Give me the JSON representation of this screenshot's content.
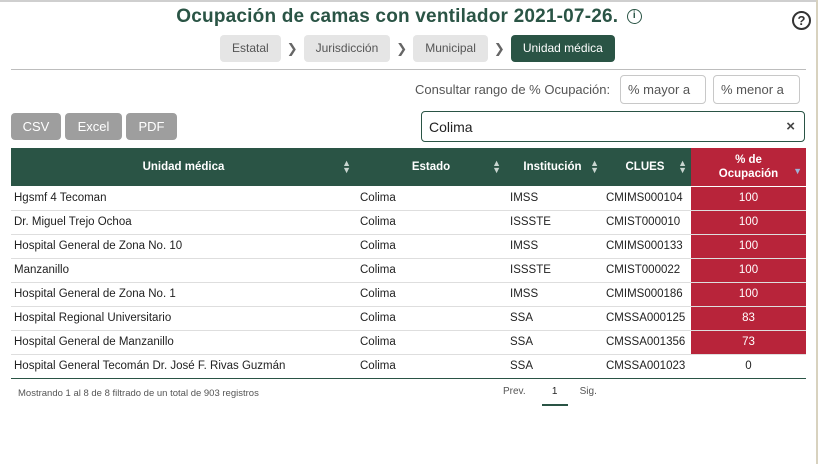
{
  "title": "Ocupación de camas con ventilador 2021-07-26.",
  "info_icon": "i",
  "help_icon": "?",
  "breadcrumbs": [
    "Estatal",
    "Jurisdicción",
    "Municipal",
    "Unidad médica"
  ],
  "breadcrumb_active": "Unidad médica",
  "range": {
    "label": "Consultar rango de % Ocupación:",
    "min_placeholder": "% mayor a",
    "max_placeholder": "% menor a"
  },
  "export": {
    "csv": "CSV",
    "excel": "Excel",
    "pdf": "PDF"
  },
  "search": {
    "value": "Colima",
    "clear": "×"
  },
  "table": {
    "headers": {
      "unidad": "Unidad médica",
      "estado": "Estado",
      "institucion": "Institución",
      "clues": "CLUES",
      "ocupacion": "% de Ocupación"
    },
    "rows": [
      {
        "unidad": "Hgsmf 4 Tecoman",
        "estado": "Colima",
        "institucion": "IMSS",
        "clues": "CMIMS000104",
        "ocupacion": "100"
      },
      {
        "unidad": "Dr. Miguel Trejo Ochoa",
        "estado": "Colima",
        "institucion": "ISSSTE",
        "clues": "CMIST000010",
        "ocupacion": "100"
      },
      {
        "unidad": "Hospital General de Zona No. 10",
        "estado": "Colima",
        "institucion": "IMSS",
        "clues": "CMIMS000133",
        "ocupacion": "100"
      },
      {
        "unidad": "Manzanillo",
        "estado": "Colima",
        "institucion": "ISSSTE",
        "clues": "CMIST000022",
        "ocupacion": "100"
      },
      {
        "unidad": "Hospital General de Zona No. 1",
        "estado": "Colima",
        "institucion": "IMSS",
        "clues": "CMIMS000186",
        "ocupacion": "100"
      },
      {
        "unidad": "Hospital Regional Universitario",
        "estado": "Colima",
        "institucion": "SSA",
        "clues": "CMSSA000125",
        "ocupacion": "83"
      },
      {
        "unidad": "Hospital General de Manzanillo",
        "estado": "Colima",
        "institucion": "SSA",
        "clues": "CMSSA001356",
        "ocupacion": "73"
      },
      {
        "unidad": "Hospital General Tecomán Dr. José F. Rivas Guzmán",
        "estado": "Colima",
        "institucion": "SSA",
        "clues": "CMSSA001023",
        "ocupacion": "0"
      }
    ]
  },
  "footer": {
    "info": "Mostrando 1 al 8 de 8 filtrado de un total de 903 registros",
    "prev": "Prev.",
    "page": "1",
    "next": "Sig."
  },
  "colors": {
    "accent": "#2a5445",
    "high_occupancy": "#b8243a"
  }
}
